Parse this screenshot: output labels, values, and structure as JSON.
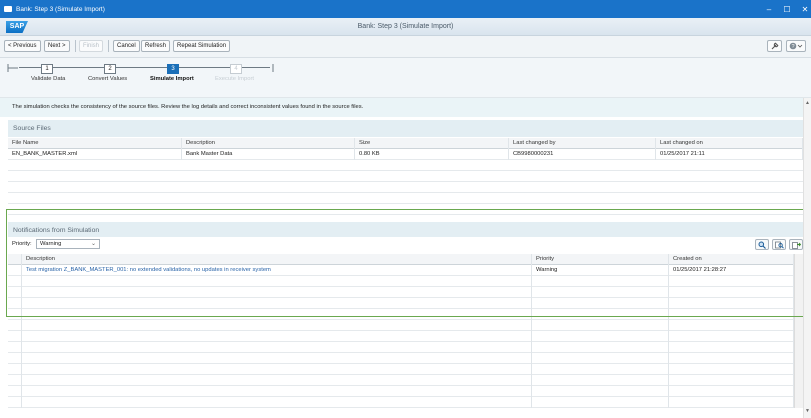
{
  "window": {
    "title": "Bank: Step 3  (Simulate Import)"
  },
  "header": {
    "logo": "SAP",
    "title": "Bank: Step 3  (Simulate Import)"
  },
  "toolbar": {
    "previous": "< Previous",
    "next": "Next >",
    "finish": "Finish",
    "cancel": "Cancel",
    "refresh": "Refresh",
    "repeat": "Repeat Simulation"
  },
  "roadmap": {
    "steps": [
      {
        "num": "1",
        "label": "Validate Data",
        "state": "done"
      },
      {
        "num": "2",
        "label": "Convert Values",
        "state": "done"
      },
      {
        "num": "3",
        "label": "Simulate Import",
        "state": "active"
      },
      {
        "num": "4",
        "label": "Execute Import",
        "state": "disabled"
      }
    ]
  },
  "info": "The simulation checks the consistency of the source files. Review the log details and correct inconsistent values found in the source files.",
  "source_files": {
    "title": "Source Files",
    "columns": [
      "File Name",
      "Description",
      "Size",
      "Last changed by",
      "Last changed on"
    ],
    "rows": [
      [
        "EN_BANK_MASTER.xml",
        "Bank Master Data",
        "0.80 KB",
        "CB9980000231",
        "01/25/2017 21:11"
      ]
    ]
  },
  "notifications": {
    "title": "Notifications from Simulation",
    "priority_label": "Priority:",
    "priority_value": "Warning",
    "columns": [
      "Description",
      "Priority",
      "Created on"
    ],
    "rows": [
      [
        "Test migration Z_BANK_MASTER_001: no extended validations, no updates in receiver system",
        "Warning",
        "01/25/2017 21:28:27"
      ]
    ]
  },
  "colors": {
    "titlebar": "#1a73c9",
    "active_step": "#1a6fb8",
    "highlight_frame": "#6aa84f",
    "link": "#2a64a8"
  }
}
